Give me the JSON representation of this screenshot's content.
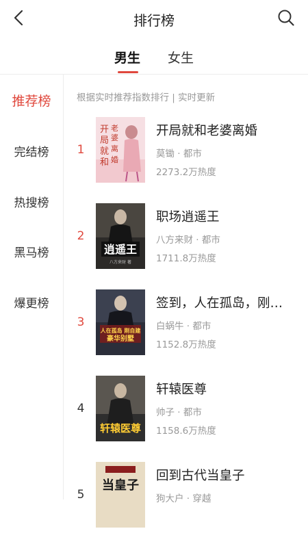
{
  "header": {
    "title": "排行榜"
  },
  "gender_tabs": [
    {
      "label": "男生"
    },
    {
      "label": "女生"
    }
  ],
  "sidebar": {
    "items": [
      {
        "label": "推荐榜"
      },
      {
        "label": "完结榜"
      },
      {
        "label": "热搜榜"
      },
      {
        "label": "黑马榜"
      },
      {
        "label": "爆更榜"
      }
    ]
  },
  "list": {
    "subtitle": "根据实时推荐指数排行 | 实时更新",
    "books": [
      {
        "rank": "1",
        "title": "开局就和老婆离婚",
        "meta": "莫锄 · 都市",
        "heat": "2273.2万热度",
        "cover_text": "开局就和老婆离婚"
      },
      {
        "rank": "2",
        "title": "职场逍遥王",
        "meta": "八方来财 · 都市",
        "heat": "1711.8万热度",
        "cover_text": "职场逍遥王"
      },
      {
        "rank": "3",
        "title": "签到，人在孤岛，刚…",
        "meta": "白蜗牛 · 都市",
        "heat": "1152.8万热度",
        "cover_text": "人在孤岛刚自建豪华别墅"
      },
      {
        "rank": "4",
        "title": "轩辕医尊",
        "meta": "帅子 · 都市",
        "heat": "1158.6万热度",
        "cover_text": "轩辕医尊"
      },
      {
        "rank": "5",
        "title": "回到古代当皇子",
        "meta": "狗大户 · 穿越",
        "heat": "",
        "cover_text": "当皇子"
      }
    ]
  },
  "colors": {
    "accent": "#e0483d",
    "muted": "#999999",
    "divider": "#ececec"
  }
}
